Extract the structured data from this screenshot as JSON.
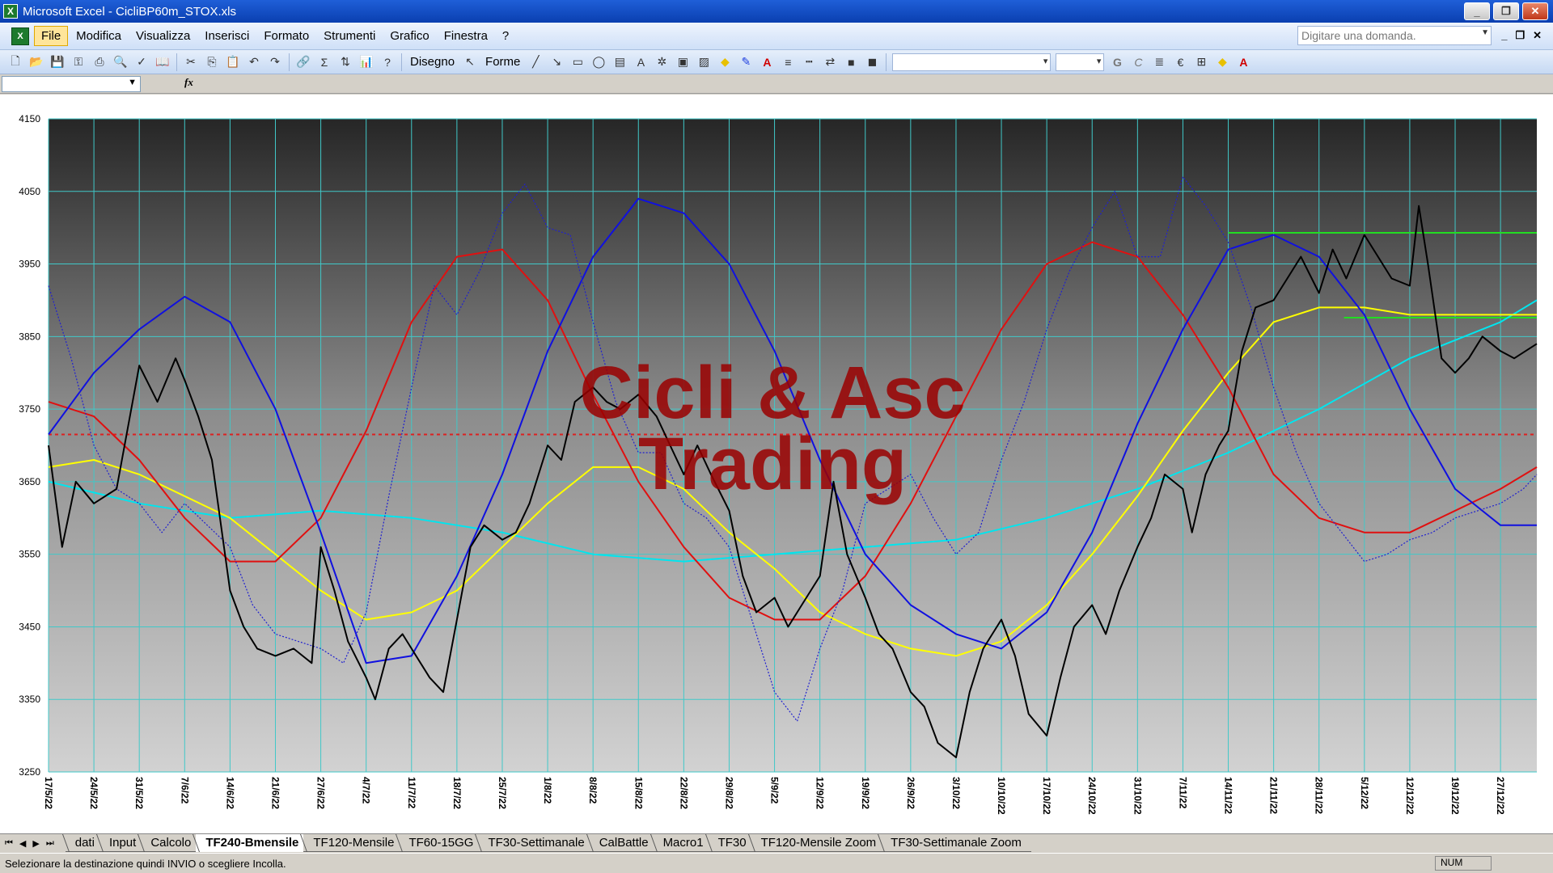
{
  "window": {
    "title": "Microsoft Excel - CicliBP60m_STOX.xls",
    "app_icon": "excel-icon"
  },
  "menubar": {
    "items": [
      "File",
      "Modifica",
      "Visualizza",
      "Inserisci",
      "Formato",
      "Strumenti",
      "Grafico",
      "Finestra",
      "?"
    ],
    "question_placeholder": "Digitare una domanda."
  },
  "toolbar": {
    "draw_label": "Disegno",
    "shapes_label": "Forme",
    "icons": [
      "new-icon",
      "open-icon",
      "save-icon",
      "permission-icon",
      "print-icon",
      "print-preview-icon",
      "spellcheck-icon",
      "research-icon",
      "cut-icon",
      "copy-icon",
      "paste-icon",
      "undo-icon",
      "redo-icon",
      "hyperlink-icon",
      "autosum-icon",
      "sort-icon",
      "chart-wizard-icon",
      "help-icon"
    ],
    "format_icons": [
      "bold-icon",
      "italic-icon",
      "align-icon",
      "euro-icon",
      "borders-icon",
      "fill-color-icon",
      "font-color-icon"
    ]
  },
  "sheet_tabs": {
    "tabs": [
      "dati",
      "Input",
      "Calcolo",
      "TF240-Bmensile",
      "TF120-Mensile",
      "TF60-15GG",
      "TF30-Settimanale",
      "CalBattle",
      "Macro1",
      "TF30",
      "TF120-Mensile Zoom",
      "TF30-Settimanale Zoom"
    ],
    "active_index": 3
  },
  "statusbar": {
    "message": "Selezionare la destinazione quindi INVIO o scegliere Incolla.",
    "num": "NUM"
  },
  "chart_data": {
    "type": "line",
    "title": "",
    "watermark": [
      "Cicli & Asc",
      "Trading"
    ],
    "ylim": [
      3250,
      4150
    ],
    "y_ticks": [
      3250,
      3350,
      3450,
      3550,
      3650,
      3750,
      3850,
      3950,
      4050,
      4150
    ],
    "x_ticks": [
      "17/5/22",
      "24/5/22",
      "31/5/22",
      "7/6/22",
      "14/6/22",
      "21/6/22",
      "27/6/22",
      "4/7/22",
      "11/7/22",
      "18/7/22",
      "25/7/22",
      "1/8/22",
      "8/8/22",
      "15/8/22",
      "22/8/22",
      "29/8/22",
      "5/9/22",
      "12/9/22",
      "19/9/22",
      "26/9/22",
      "3/10/22",
      "10/10/22",
      "17/10/22",
      "24/10/22",
      "31/10/22",
      "7/11/22",
      "14/11/22",
      "21/11/22",
      "28/11/22",
      "5/12/22",
      "12/12/22",
      "19/12/22",
      "27/12/22"
    ],
    "grid": true,
    "colors": {
      "price": "#000000",
      "dotted_price": "#2020d0",
      "blue_cycle": "#1010e0",
      "red_cycle": "#e01010",
      "yellow_ma": "#ffff00",
      "cyan_ma": "#00e5ee",
      "green_levels": "#22dd22",
      "red_dotted_level": "#dd2020",
      "grid": "#40c8c8",
      "watermark": "#9a0000"
    },
    "horizontal_levels": [
      {
        "value": 3715,
        "style": "dotted",
        "color": "red",
        "x_start": "17/5/22"
      },
      {
        "value": 3993,
        "style": "solid",
        "color": "green",
        "x_start": "14/11/22"
      },
      {
        "value": 3876,
        "style": "solid",
        "color": "green",
        "x_start": "2/12/22"
      }
    ],
    "series": [
      {
        "kind": "price",
        "x_index": [
          0,
          0.3,
          0.6,
          1,
          1.5,
          2,
          2.4,
          2.8,
          3,
          3.3,
          3.6,
          4,
          4.3,
          4.6,
          5,
          5.4,
          5.8,
          6,
          6.3,
          6.6,
          7,
          7.2,
          7.5,
          7.8,
          8,
          8.4,
          8.7,
          9,
          9.3,
          9.6,
          10,
          10.3,
          10.6,
          11,
          11.3,
          11.6,
          12,
          12.3,
          12.6,
          13,
          13.4,
          13.7,
          14,
          14.3,
          14.6,
          15,
          15.3,
          15.6,
          16,
          16.3,
          16.6,
          17,
          17.3,
          17.6,
          18,
          18.3,
          18.6,
          19,
          19.3,
          19.6,
          20,
          20.3,
          20.6,
          21,
          21.3,
          21.6,
          22,
          22.3,
          22.6,
          23,
          23.3,
          23.6,
          24,
          24.3,
          24.6,
          25,
          25.2,
          25.5,
          25.8,
          26,
          26.3,
          26.6,
          27,
          27.3,
          27.6,
          28,
          28.3,
          28.6,
          29,
          29.3,
          29.6,
          30,
          30.2,
          30.4,
          30.7,
          31,
          31.3,
          31.6,
          32,
          32.3,
          32.8
        ],
        "values": [
          3700,
          3560,
          3650,
          3620,
          3640,
          3810,
          3760,
          3820,
          3790,
          3740,
          3680,
          3500,
          3450,
          3420,
          3410,
          3420,
          3400,
          3560,
          3500,
          3430,
          3380,
          3350,
          3420,
          3440,
          3420,
          3380,
          3360,
          3460,
          3560,
          3590,
          3570,
          3580,
          3620,
          3700,
          3680,
          3760,
          3780,
          3760,
          3750,
          3770,
          3740,
          3700,
          3660,
          3700,
          3660,
          3610,
          3520,
          3470,
          3490,
          3450,
          3480,
          3520,
          3650,
          3550,
          3490,
          3440,
          3420,
          3360,
          3340,
          3290,
          3270,
          3360,
          3420,
          3460,
          3410,
          3330,
          3300,
          3380,
          3450,
          3480,
          3440,
          3500,
          3560,
          3600,
          3660,
          3640,
          3580,
          3660,
          3700,
          3720,
          3830,
          3890,
          3900,
          3930,
          3960,
          3910,
          3970,
          3930,
          3990,
          3960,
          3930,
          3920,
          4030,
          3950,
          3820,
          3800,
          3820,
          3850,
          3830,
          3820,
          3840,
          3850,
          3920
        ]
      },
      {
        "kind": "dotted_price",
        "x_index": [
          0,
          0.5,
          1,
          1.5,
          2,
          2.5,
          3,
          3.5,
          4,
          4.5,
          5,
          5.5,
          6,
          6.5,
          7,
          7.5,
          8,
          8.5,
          9,
          9.5,
          10,
          10.5,
          11,
          11.5,
          12,
          12.5,
          13,
          13.5,
          14,
          14.5,
          15,
          15.5,
          16,
          16.5,
          17,
          17.5,
          18,
          18.5,
          19,
          19.5,
          20,
          20.5,
          21,
          21.5,
          22,
          22.5,
          23,
          23.5,
          24,
          24.5,
          25,
          25.5,
          26,
          26.5,
          27,
          27.5,
          28,
          28.5,
          29,
          29.5,
          30,
          30.5,
          31,
          31.5,
          32,
          32.5,
          32.8
        ],
        "values": [
          3920,
          3820,
          3700,
          3640,
          3620,
          3580,
          3620,
          3590,
          3560,
          3480,
          3440,
          3430,
          3420,
          3400,
          3470,
          3630,
          3780,
          3920,
          3880,
          3940,
          4020,
          4060,
          4000,
          3990,
          3870,
          3760,
          3690,
          3690,
          3620,
          3600,
          3560,
          3460,
          3360,
          3320,
          3420,
          3500,
          3620,
          3640,
          3660,
          3600,
          3550,
          3580,
          3680,
          3760,
          3860,
          3940,
          4000,
          4050,
          3960,
          3960,
          4070,
          4030,
          3980,
          3890,
          3780,
          3690,
          3620,
          3580,
          3540,
          3550,
          3570,
          3580,
          3600,
          3610,
          3620,
          3640,
          3660
        ]
      },
      {
        "kind": "blue_cycle",
        "x_index": [
          0,
          1,
          2,
          3,
          4,
          5,
          6,
          7,
          8,
          9,
          10,
          11,
          12,
          13,
          14,
          15,
          16,
          17,
          18,
          19,
          20,
          21,
          22,
          23,
          24,
          25,
          26,
          27,
          28,
          29,
          30,
          31,
          32,
          32.8
        ],
        "values": [
          3715,
          3800,
          3860,
          3905,
          3870,
          3750,
          3580,
          3400,
          3410,
          3520,
          3660,
          3830,
          3960,
          4040,
          4020,
          3950,
          3830,
          3680,
          3550,
          3480,
          3440,
          3420,
          3470,
          3580,
          3730,
          3860,
          3970,
          3990,
          3960,
          3880,
          3750,
          3640,
          3590,
          3590
        ]
      },
      {
        "kind": "red_cycle",
        "x_index": [
          0,
          1,
          2,
          3,
          4,
          5,
          6,
          7,
          8,
          9,
          10,
          11,
          12,
          13,
          14,
          15,
          16,
          17,
          18,
          19,
          20,
          21,
          22,
          23,
          24,
          25,
          26,
          27,
          28,
          29,
          30,
          31,
          32,
          32.8
        ],
        "values": [
          3760,
          3740,
          3680,
          3600,
          3540,
          3540,
          3600,
          3720,
          3870,
          3960,
          3970,
          3900,
          3770,
          3650,
          3560,
          3490,
          3460,
          3460,
          3520,
          3620,
          3740,
          3860,
          3950,
          3980,
          3960,
          3880,
          3780,
          3660,
          3600,
          3580,
          3580,
          3610,
          3640,
          3670
        ]
      },
      {
        "kind": "yellow_ma",
        "x_index": [
          0,
          1,
          2,
          3,
          4,
          5,
          6,
          7,
          8,
          9,
          10,
          11,
          12,
          13,
          14,
          15,
          16,
          17,
          18,
          19,
          20,
          21,
          22,
          23,
          24,
          25,
          26,
          27,
          28,
          29,
          30,
          31,
          32,
          32.8
        ],
        "values": [
          3670,
          3680,
          3660,
          3630,
          3600,
          3550,
          3500,
          3460,
          3470,
          3500,
          3560,
          3620,
          3670,
          3670,
          3640,
          3580,
          3530,
          3470,
          3440,
          3420,
          3410,
          3430,
          3480,
          3550,
          3630,
          3720,
          3800,
          3870,
          3890,
          3890,
          3880,
          3880,
          3880,
          3880
        ]
      },
      {
        "kind": "cyan_ma",
        "x_index": [
          0,
          2,
          4,
          6,
          8,
          10,
          12,
          14,
          16,
          18,
          20,
          22,
          24,
          26,
          28,
          30,
          32,
          32.8
        ],
        "values": [
          3650,
          3620,
          3600,
          3610,
          3600,
          3580,
          3550,
          3540,
          3550,
          3560,
          3570,
          3600,
          3640,
          3690,
          3750,
          3820,
          3870,
          3900
        ]
      }
    ]
  }
}
